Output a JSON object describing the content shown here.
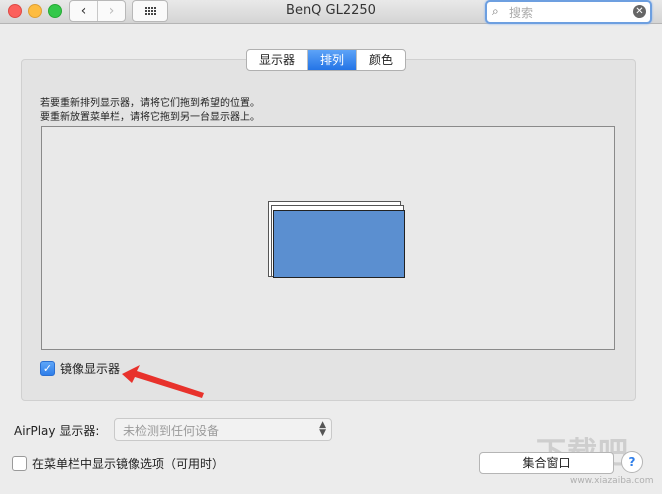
{
  "window": {
    "title": "BenQ GL2250"
  },
  "toolbar": {
    "back_glyph": "‹",
    "forward_glyph": "›",
    "search_placeholder": "搜索",
    "search_icon_glyph": "⌕",
    "clear_glyph": "✕"
  },
  "tabs": [
    {
      "label": "显示器",
      "active": false
    },
    {
      "label": "排列",
      "active": true
    },
    {
      "label": "颜色",
      "active": false
    }
  ],
  "instructions": {
    "line1": "若要重新排列显示器，请将它们拖到希望的位置。",
    "line2": "要重新放置菜单栏，请将它拖到另一台显示器上。"
  },
  "mirror": {
    "label": "镜像显示器",
    "checked": true,
    "check_glyph": "✓"
  },
  "airplay": {
    "label": "AirPlay 显示器:",
    "value": "未检测到任何设备"
  },
  "menubar_option": {
    "label": "在菜单栏中显示镜像选项（可用时）",
    "checked": false
  },
  "buttons": {
    "gather": "集合窗口",
    "help": "?"
  },
  "watermark": {
    "text": "下载吧",
    "url": "www.xiazaiba.com"
  },
  "colors": {
    "accent": "#2f7ee9",
    "display": "#5b8fd0",
    "arrow": "#e8322c"
  }
}
